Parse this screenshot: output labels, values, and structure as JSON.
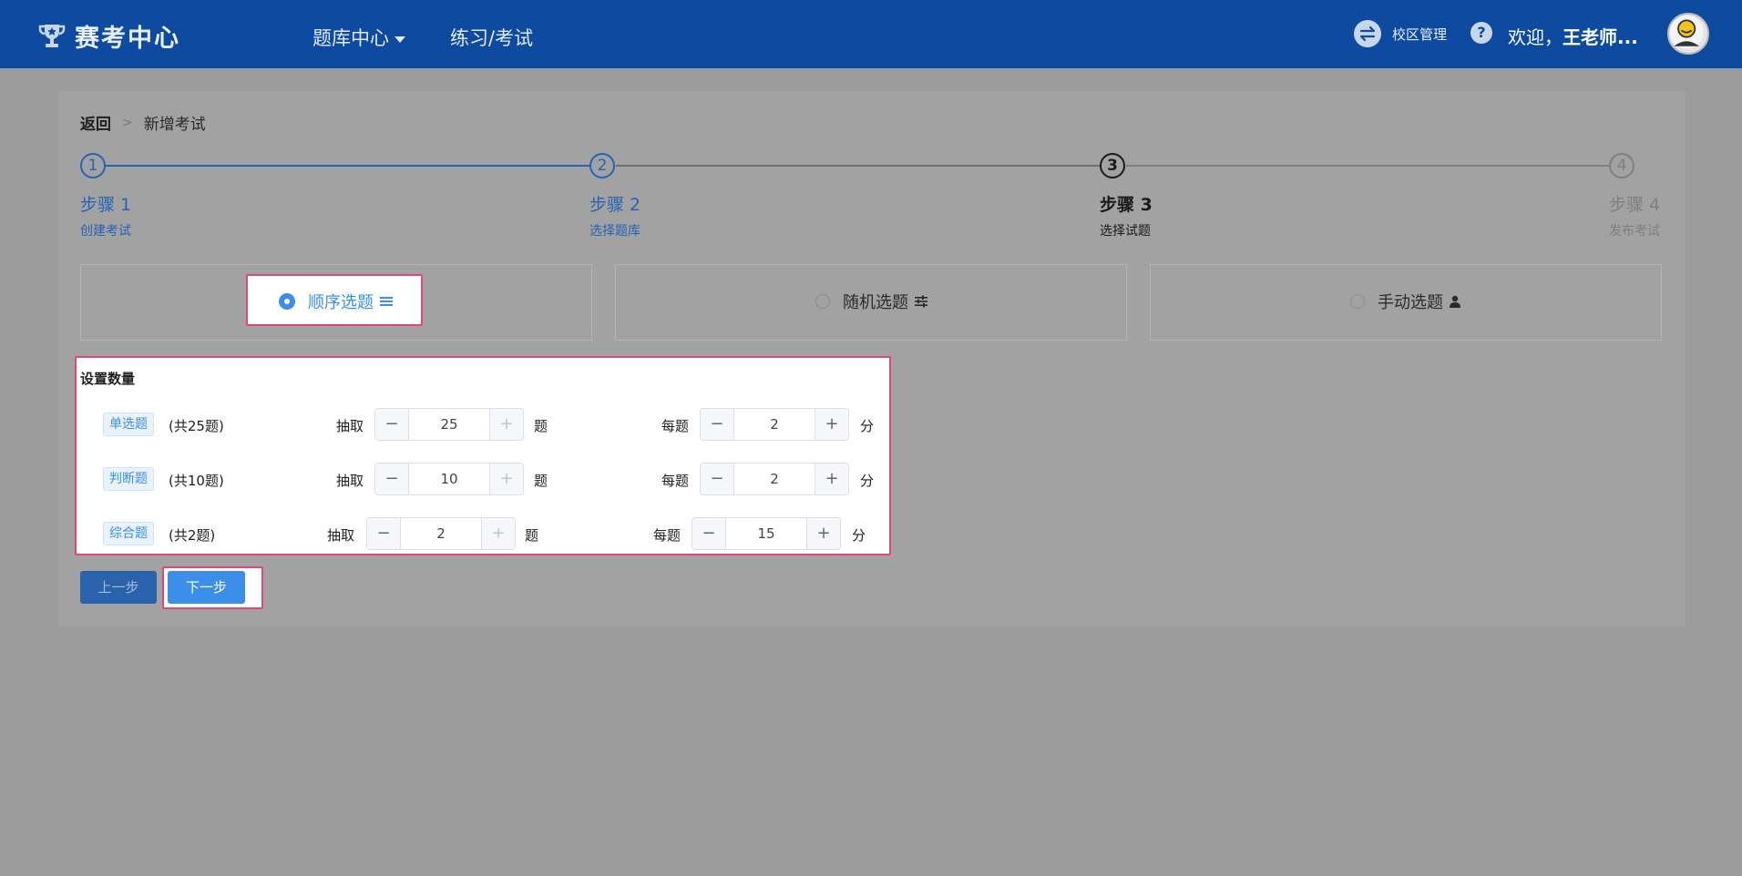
{
  "header": {
    "brand": "赛考中心",
    "nav": [
      {
        "label": "题库中心"
      },
      {
        "label": "练习/考试"
      }
    ],
    "campus_label": "校区管理",
    "help": "?",
    "welcome_prefix": "欢迎，",
    "welcome_name": "王老师..."
  },
  "breadcrumb": {
    "back": "返回",
    "separator": ">",
    "current": "新增考试"
  },
  "steps": [
    {
      "num": "1",
      "title": "步骤 1",
      "desc": "创建考试",
      "status": "done"
    },
    {
      "num": "2",
      "title": "步骤 2",
      "desc": "选择题库",
      "status": "done"
    },
    {
      "num": "3",
      "title": "步骤 3",
      "desc": "选择试题",
      "status": "active"
    },
    {
      "num": "4",
      "title": "步骤 4",
      "desc": "发布考试",
      "status": "wait"
    }
  ],
  "modes": [
    {
      "label": "顺序选题",
      "selected": true,
      "icon": "list-icon"
    },
    {
      "label": "随机选题",
      "selected": false,
      "icon": "sliders-icon"
    },
    {
      "label": "手动选题",
      "selected": false,
      "icon": "user-icon"
    }
  ],
  "quantity": {
    "title": "设置数量",
    "draw_label": "抽取",
    "unit_label": "题",
    "per_label": "每题",
    "score_unit": "分",
    "rows": [
      {
        "type": "单选题",
        "total": "(共25题)",
        "count": "25",
        "score": "2"
      },
      {
        "type": "判断题",
        "total": "(共10题)",
        "count": "10",
        "score": "2"
      },
      {
        "type": "综合题",
        "total": "(共2题)",
        "count": "2",
        "score": "15"
      }
    ],
    "minus": "−",
    "plus": "+"
  },
  "buttons": {
    "prev": "上一步",
    "next": "下一步"
  },
  "colors": {
    "header_bg": "#0e4a9f",
    "primary": "#3b8fe9",
    "highlight_border": "#e6457a"
  }
}
